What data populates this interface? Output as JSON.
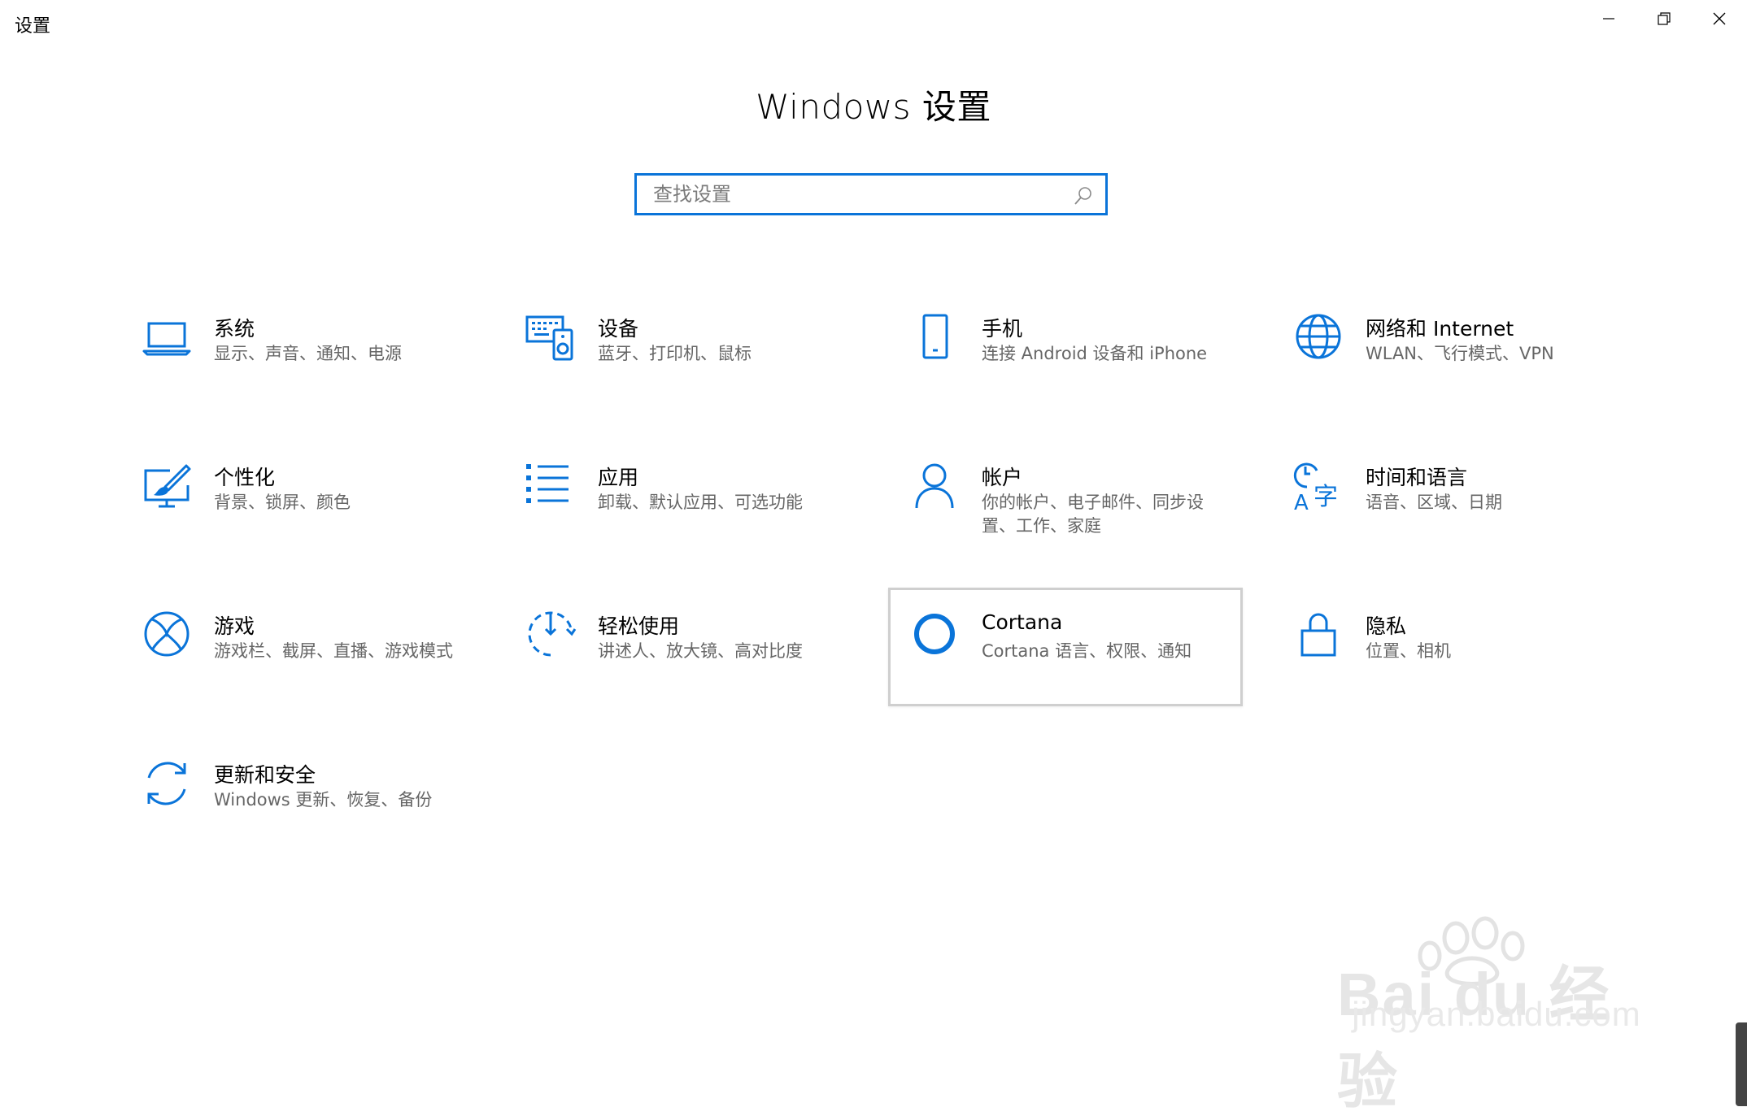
{
  "window": {
    "app_title": "设置",
    "minimize_label": "minimize",
    "restore_label": "restore",
    "close_label": "close"
  },
  "page": {
    "title": "Windows 设置"
  },
  "search": {
    "placeholder": "查找设置",
    "value": "",
    "icon": "search-icon"
  },
  "accent_color": "#0a74d9",
  "tiles": [
    {
      "key": "system",
      "icon": "laptop-icon",
      "name": "系统",
      "desc": "显示、声音、通知、电源"
    },
    {
      "key": "devices",
      "icon": "keyboard-speaker-icon",
      "name": "设备",
      "desc": "蓝牙、打印机、鼠标"
    },
    {
      "key": "phone",
      "icon": "phone-icon",
      "name": "手机",
      "desc": "连接 Android 设备和 iPhone"
    },
    {
      "key": "network",
      "icon": "globe-icon",
      "name": "网络和 Internet",
      "desc": "WLAN、飞行模式、VPN"
    },
    {
      "key": "personalization",
      "icon": "paint-monitor-icon",
      "name": "个性化",
      "desc": "背景、锁屏、颜色"
    },
    {
      "key": "apps",
      "icon": "app-list-icon",
      "name": "应用",
      "desc": "卸载、默认应用、可选功能"
    },
    {
      "key": "accounts",
      "icon": "person-icon",
      "name": "帐户",
      "desc": "你的帐户、电子邮件、同步设置、工作、家庭"
    },
    {
      "key": "time-language",
      "icon": "time-language-icon",
      "name": "时间和语言",
      "desc": "语音、区域、日期"
    },
    {
      "key": "gaming",
      "icon": "xbox-icon",
      "name": "游戏",
      "desc": "游戏栏、截屏、直播、游戏模式"
    },
    {
      "key": "ease-of-access",
      "icon": "ease-of-access-icon",
      "name": "轻松使用",
      "desc": "讲述人、放大镜、高对比度"
    },
    {
      "key": "cortana",
      "icon": "cortana-icon",
      "name": "Cortana",
      "desc": "Cortana 语言、权限、通知"
    },
    {
      "key": "privacy",
      "icon": "lock-icon",
      "name": "隐私",
      "desc": "位置、相机"
    },
    {
      "key": "update-security",
      "icon": "sync-icon",
      "name": "更新和安全",
      "desc": "Windows 更新、恢复、备份"
    }
  ],
  "watermark": {
    "logo_text": "Bai du 经验",
    "url_text": "jingyan.baidu.com"
  }
}
